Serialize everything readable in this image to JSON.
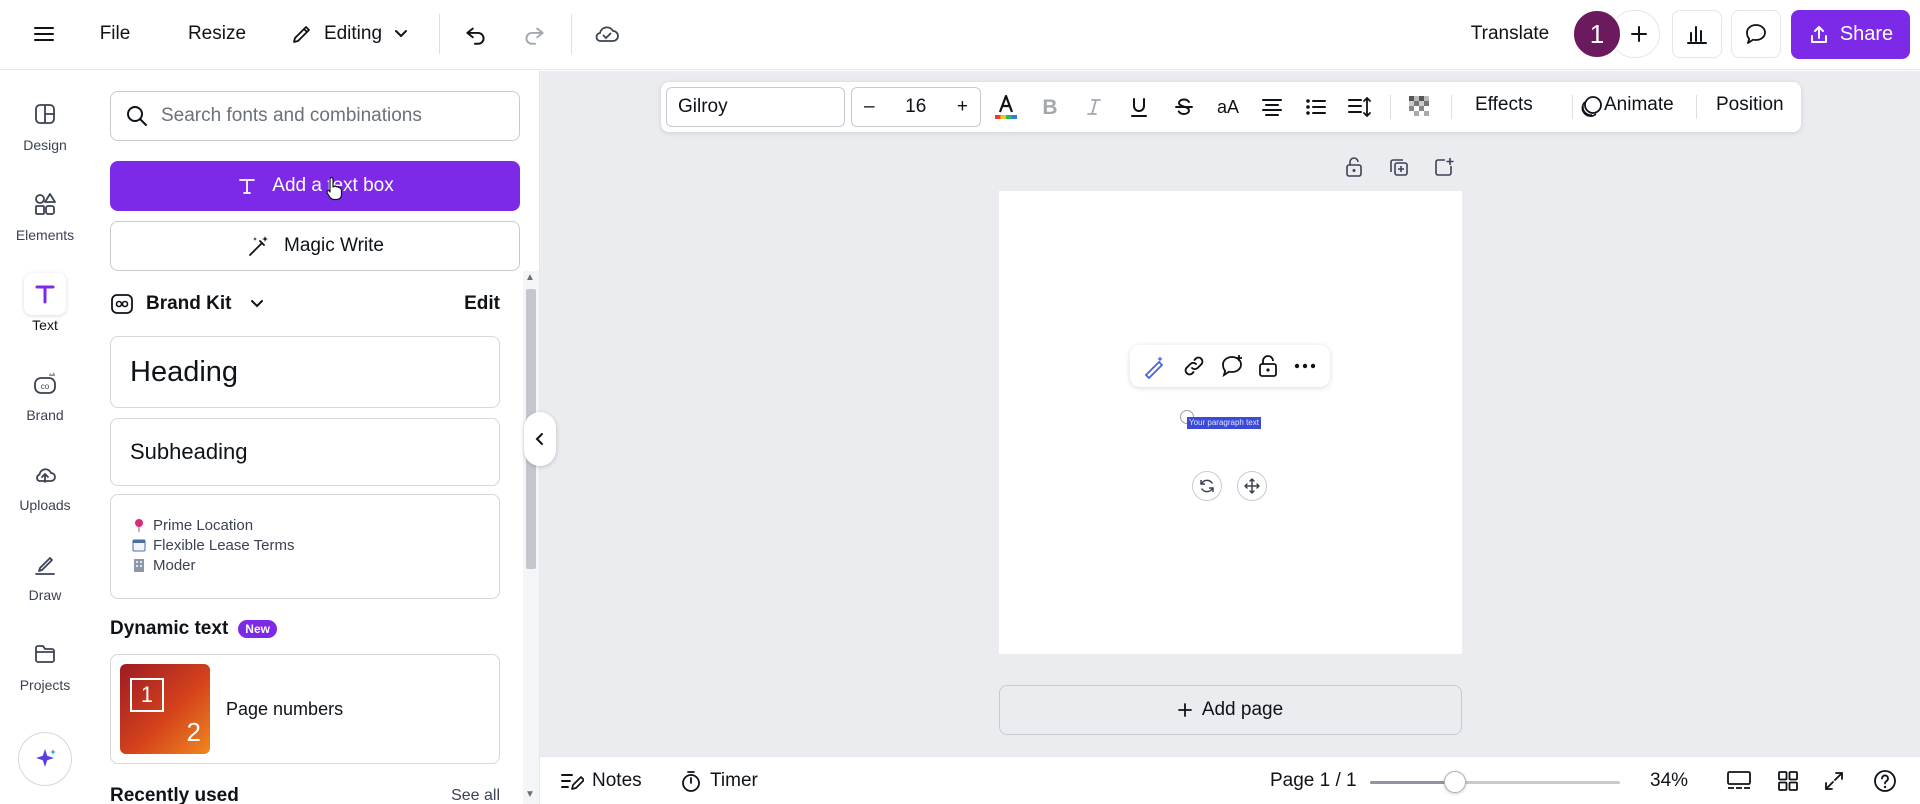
{
  "topbar": {
    "file_label": "File",
    "resize_label": "Resize",
    "editing_label": "Editing",
    "translate_label": "Translate",
    "avatar_initial": "1",
    "share_label": "Share",
    "accent_color": "#7d2ae8",
    "avatar_color": "#6b1a5d"
  },
  "rail": {
    "items": [
      {
        "label": "Design",
        "icon": "design-icon"
      },
      {
        "label": "Elements",
        "icon": "elements-icon"
      },
      {
        "label": "Text",
        "icon": "text-icon"
      },
      {
        "label": "Brand",
        "icon": "brand-icon"
      },
      {
        "label": "Uploads",
        "icon": "uploads-icon"
      },
      {
        "label": "Draw",
        "icon": "draw-icon"
      },
      {
        "label": "Projects",
        "icon": "projects-icon"
      }
    ],
    "active": "Text"
  },
  "panel": {
    "search_placeholder": "Search fonts and combinations",
    "add_text_box_label": "Add a text box",
    "magic_write_label": "Magic Write",
    "brand_kit_label": "Brand Kit",
    "brand_kit_edit": "Edit",
    "heading_label": "Heading",
    "subheading_label": "Subheading",
    "body_lines": [
      "Prime Location",
      "Flexible Lease Terms",
      "Moder"
    ],
    "dynamic_text_label": "Dynamic text",
    "new_badge": "New",
    "page_numbers_label": "Page numbers",
    "page_numbers_thumb_a": "1",
    "page_numbers_thumb_b": "2",
    "recently_used_label": "Recently used",
    "see_all_label": "See all"
  },
  "format_bar": {
    "font_name": "Gilroy",
    "font_size_minus": "–",
    "font_size": "16",
    "font_size_plus": "+",
    "effects_label": "Effects",
    "animate_label": "Animate",
    "position_label": "Position"
  },
  "canvas": {
    "selected_text": "Your paragraph text",
    "add_page_label": "Add page"
  },
  "bottombar": {
    "notes_label": "Notes",
    "timer_label": "Timer",
    "page_indicator": "Page 1 / 1",
    "zoom_label": "34%",
    "zoom_fraction": 0.34
  }
}
